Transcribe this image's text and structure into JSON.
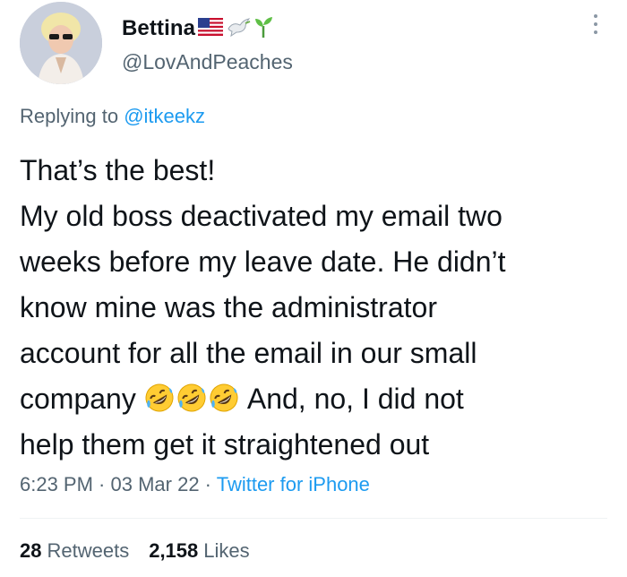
{
  "author": {
    "display_name": "Bettina",
    "handle": "@LovAndPeaches",
    "name_emojis": [
      "us-flag-icon",
      "dove-icon",
      "seedling-icon"
    ]
  },
  "reply": {
    "prefix": "Replying to ",
    "handle": "@itkeekz"
  },
  "tweet": {
    "line1": "That’s the best!",
    "line2": "My old boss deactivated my email two",
    "line3": "weeks before my leave date. He didn’t",
    "line4": "know mine was the administrator",
    "line5": "account for all the email in our small",
    "line6_start": "company ",
    "line6_end": " And, no, I did not",
    "line7": "help them get it straightened out",
    "emojis": [
      "rolling-on-floor-laughing-icon",
      "rolling-on-floor-laughing-icon",
      "rolling-on-floor-laughing-icon"
    ]
  },
  "meta": {
    "time": "6:23 PM",
    "sep1": " · ",
    "date": "03 Mar 22",
    "sep2": " · ",
    "source": "Twitter for iPhone"
  },
  "stats": {
    "retweets_count": "28",
    "retweets_label": "Retweets",
    "likes_count": "2,158",
    "likes_label": "Likes"
  },
  "colors": {
    "text": "#0f1419",
    "secondary": "#536471",
    "link": "#1d9bf0",
    "divider": "#eff3f4"
  }
}
